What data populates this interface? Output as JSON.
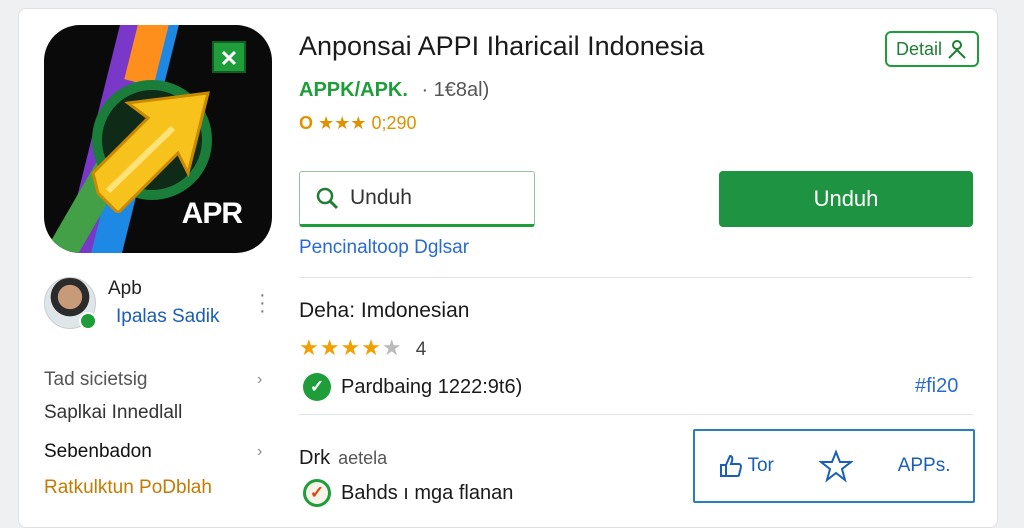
{
  "app": {
    "title": "Anponsai APPI Iharicail Indonesia",
    "publisher": "APPK/APK.",
    "publisher_meta": "·   1€8al)",
    "rating_prefix": "O",
    "rating_stars": "★★★",
    "rating_value": "0;290",
    "icon_label": "APR"
  },
  "buttons": {
    "detail_label": "Detail",
    "install_label": "Unduh"
  },
  "search": {
    "value": "Unduh",
    "placeholder": "Unduh"
  },
  "link_under_search": "Pencinaltoop Dglsar",
  "sidebar": {
    "profile_name": "Apb",
    "profile_sub": "Ipalas Sadik",
    "items": [
      {
        "label": "Tad sicietsig",
        "color": "#555555",
        "chevron": true
      },
      {
        "label": "Saplkai Innedlall",
        "color": "#333333",
        "chevron": false
      },
      {
        "label": "Sebenbadon",
        "color": "#111111",
        "chevron": true
      },
      {
        "label": "Ratkulktun PoDblah",
        "color": "#c47a00",
        "chevron": false
      }
    ]
  },
  "details": {
    "language_line": "Deha: Imdonesian",
    "stars_filled": "★★★★",
    "stars_empty": "★",
    "stars_count": "4",
    "verify_text": "Pardbaing 1222:9t6)",
    "hash_link": "#fi20",
    "drk_label": "Drk",
    "drk_value": "aetela",
    "bahasa_text": "Bahds ı mga flanan"
  },
  "actions": [
    {
      "icon": "thumb-up-icon",
      "label": "Tor"
    },
    {
      "icon": "star-icon",
      "label": ""
    },
    {
      "icon": "apps-icon",
      "label": "APPs."
    }
  ],
  "colors": {
    "accent_green": "#1e9442",
    "link_blue": "#2a6bd1",
    "star_orange": "#f0a000"
  }
}
